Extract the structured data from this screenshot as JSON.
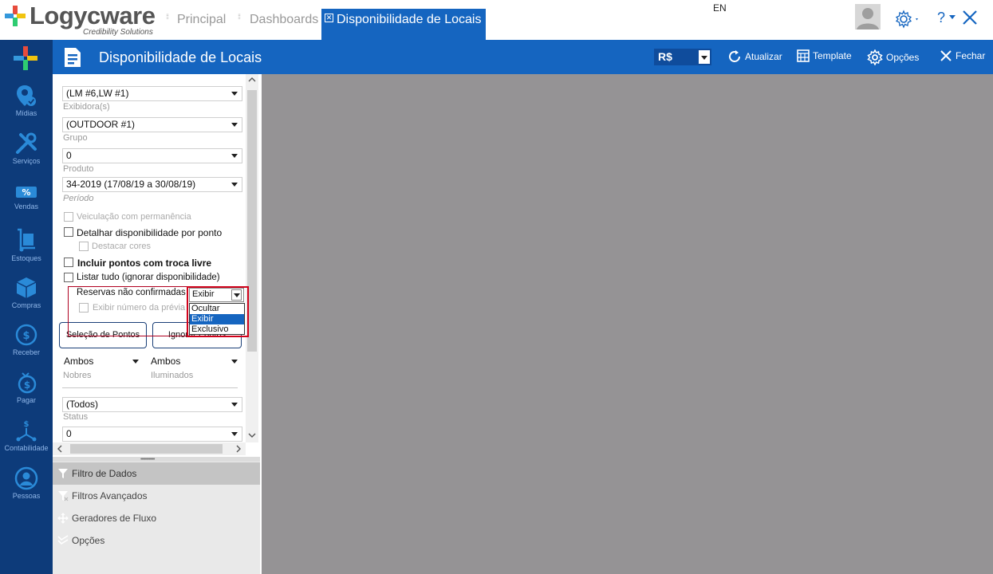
{
  "app": {
    "logo_text": "Logycware",
    "logo_sub": "Credibility Solutions",
    "language": "EN"
  },
  "tabs": [
    {
      "label": "Principal",
      "active": false
    },
    {
      "label": "Dashboards",
      "active": false
    },
    {
      "label": "Disponibilidade de Locais",
      "active": true
    }
  ],
  "header": {
    "title": "Disponibilidade de Locais",
    "currency": "R$",
    "buttons": {
      "refresh": "Atualizar",
      "template": "Template",
      "options": "Opções",
      "close": "Fechar"
    }
  },
  "nav": [
    {
      "label": "Mídias",
      "icon": "map-pin-icon"
    },
    {
      "label": "Serviços",
      "icon": "tools-icon"
    },
    {
      "label": "Vendas",
      "icon": "percent-tag-icon"
    },
    {
      "label": "Estoques",
      "icon": "hand-truck-icon"
    },
    {
      "label": "Compras",
      "icon": "box-icon"
    },
    {
      "label": "Receber",
      "icon": "coin-icon"
    },
    {
      "label": "Pagar",
      "icon": "money-bag-icon"
    },
    {
      "label": "Contabilidade",
      "icon": "balance-icon"
    },
    {
      "label": "Pessoas",
      "icon": "person-icon"
    }
  ],
  "form": {
    "exibidora": {
      "value": "(LM #6,LW #1)",
      "label": "Exibidora(s)"
    },
    "grupo": {
      "value": "(OUTDOOR #1)",
      "label": "Grupo"
    },
    "produto": {
      "value": "0",
      "label": "Produto"
    },
    "periodo": {
      "value": "34-2019 (17/08/19 a 30/08/19)",
      "label": "Período"
    },
    "checks": {
      "veiculacao": "Veiculação com permanência",
      "detalhar": "Detalhar disponibilidade por ponto",
      "destacar": "Destacar cores",
      "incluir": "Incluir pontos com troca livre",
      "listar": "Listar tudo (ignorar disponibilidade)",
      "exibir_numero": "Exibir número da prévia"
    },
    "reservas": {
      "label": "Reservas não confirmadas",
      "value": "Exibir",
      "options": [
        "Ocultar",
        "Exibir",
        "Exclusivo"
      ]
    },
    "buttons": {
      "selecao": "Seleção de Pontos",
      "ignorar": "Ignorar Pontos"
    },
    "nobres": {
      "value": "Ambos",
      "label": "Nobres"
    },
    "iluminados": {
      "value": "Ambos",
      "label": "Iluminados"
    },
    "status": {
      "value": "(Todos)",
      "label": "Status"
    },
    "last": {
      "value": "0"
    }
  },
  "accordion": [
    "Filtro de Dados",
    "Filtros Avançados",
    "Geradores de Fluxo",
    "Opções"
  ],
  "colors": {
    "brand_blue": "#1565c0",
    "nav_blue": "#0d3b7a",
    "content_gray": "#959395",
    "annotation_red": "#d0021b"
  }
}
